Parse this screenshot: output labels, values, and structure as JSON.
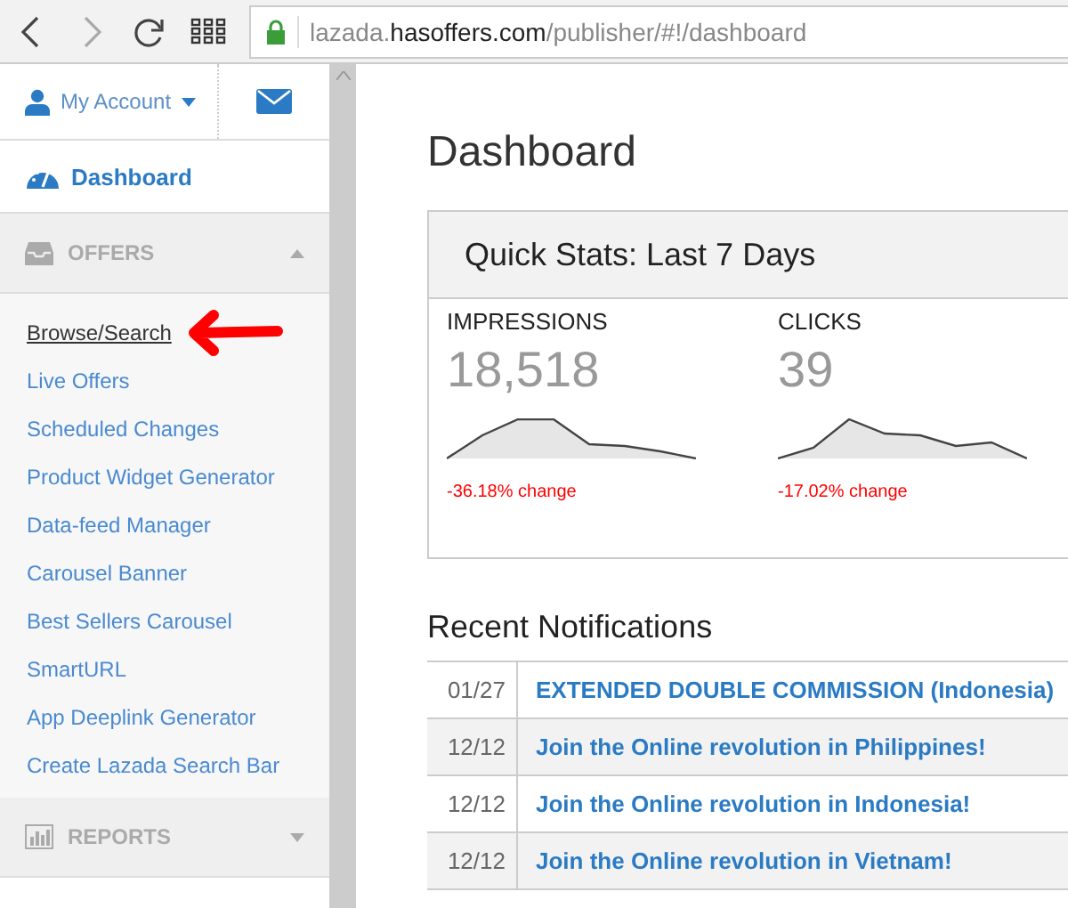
{
  "browser": {
    "url_prefix": "lazada.",
    "url_domain": "hasoffers.com",
    "url_path": "/publisher/#!/dashboard"
  },
  "sidebar": {
    "account_label": "My Account",
    "dashboard_label": "Dashboard",
    "sections": [
      {
        "title": "OFFERS",
        "expanded": true,
        "items": [
          {
            "label": "Browse/Search",
            "selected": true
          },
          {
            "label": "Live Offers",
            "selected": false
          },
          {
            "label": "Scheduled Changes",
            "selected": false
          },
          {
            "label": "Product Widget Generator",
            "selected": false
          },
          {
            "label": "Data-feed Manager",
            "selected": false
          },
          {
            "label": "Carousel Banner",
            "selected": false
          },
          {
            "label": "Best Sellers Carousel",
            "selected": false
          },
          {
            "label": "SmartURL",
            "selected": false
          },
          {
            "label": "App Deeplink Generator",
            "selected": false
          },
          {
            "label": "Create Lazada Search Bar",
            "selected": false
          }
        ]
      },
      {
        "title": "REPORTS",
        "expanded": false
      }
    ]
  },
  "page_title": "Dashboard",
  "quick_stats": {
    "title": "Quick Stats: Last 7 Days",
    "stats": [
      {
        "label": "IMPRESSIONS",
        "value": "18,518",
        "change": "-36.18% change"
      },
      {
        "label": "CLICKS",
        "value": "39",
        "change": "-17.02% change"
      }
    ]
  },
  "notifications": {
    "title": "Recent Notifications",
    "rows": [
      {
        "date": "01/27",
        "text": "EXTENDED DOUBLE COMMISSION (Indonesia)"
      },
      {
        "date": "12/12",
        "text": "Join the Online revolution in Philippines!"
      },
      {
        "date": "12/12",
        "text": "Join the Online revolution in Indonesia!"
      },
      {
        "date": "12/12",
        "text": "Join the Online revolution in Vietnam!"
      }
    ]
  }
}
